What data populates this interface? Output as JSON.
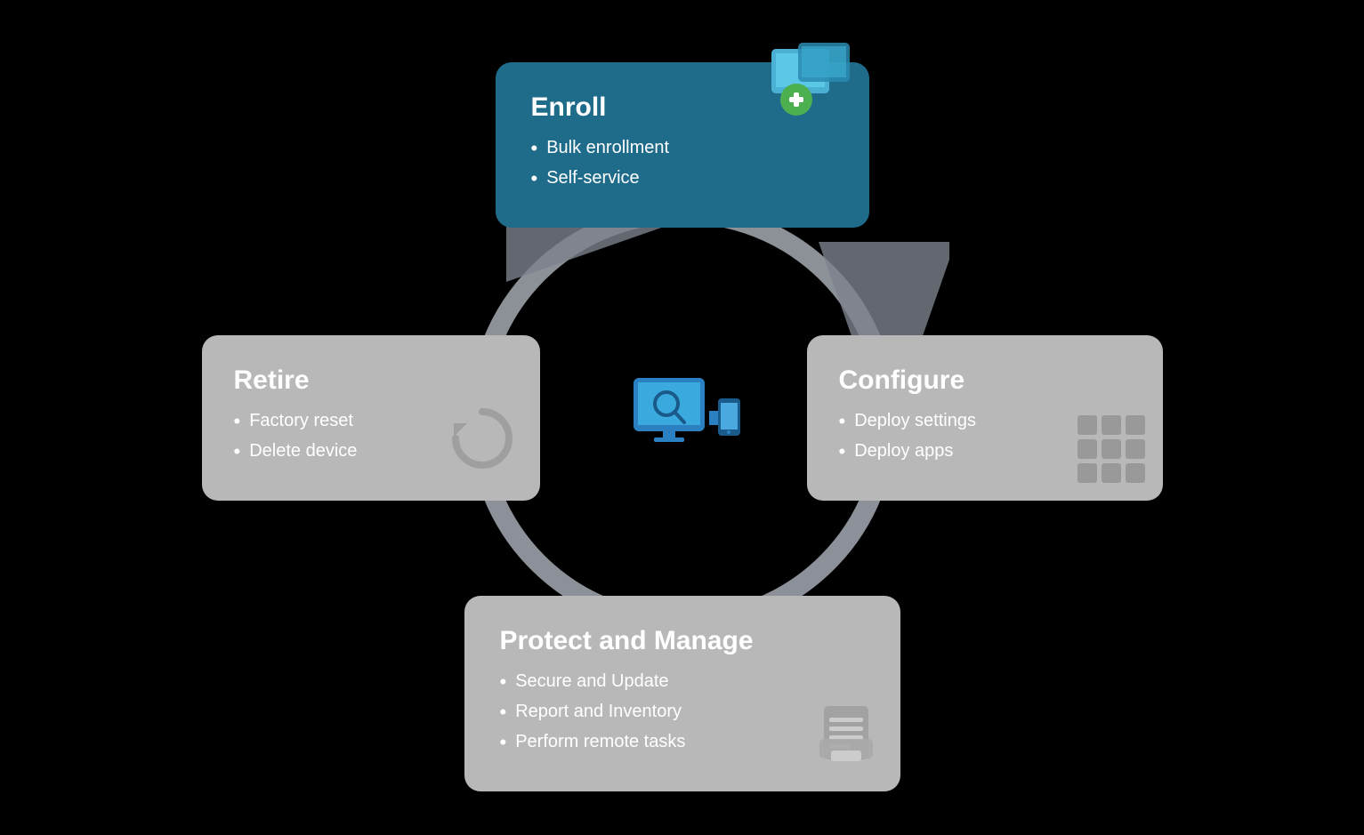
{
  "background": "#000000",
  "cards": {
    "enroll": {
      "title": "Enroll",
      "items": [
        "Bulk enrollment",
        "Self-service"
      ],
      "bg": "#1e6b8a"
    },
    "retire": {
      "title": "Retire",
      "items": [
        "Factory reset",
        "Delete device"
      ],
      "bg": "#b8b8b8"
    },
    "configure": {
      "title": "Configure",
      "items": [
        "Deploy settings",
        "Deploy apps"
      ],
      "bg": "#b8b8b8"
    },
    "protect": {
      "title": "Protect and Manage",
      "items": [
        "Secure and Update",
        "Report and Inventory",
        "Perform remote tasks"
      ],
      "bg": "#b8b8b8"
    }
  }
}
